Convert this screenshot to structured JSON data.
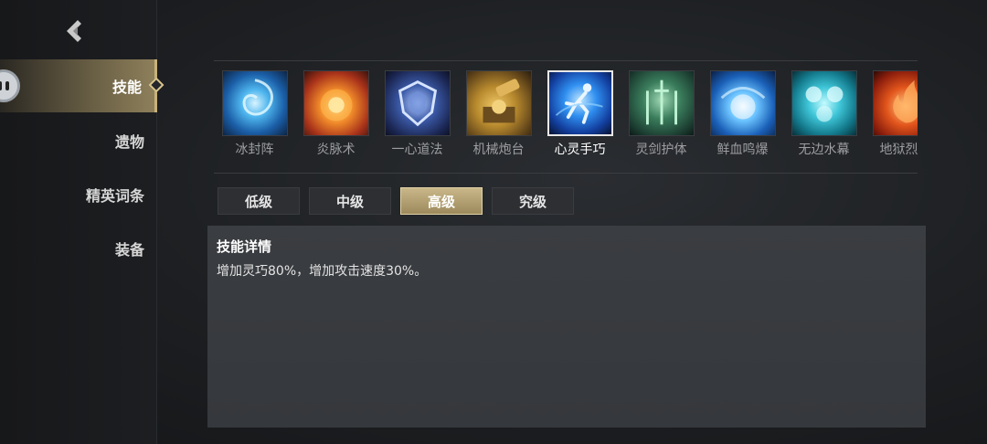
{
  "sidebar": {
    "items": [
      {
        "label": "技能",
        "active": true
      },
      {
        "label": "遗物",
        "active": false
      },
      {
        "label": "精英词条",
        "active": false
      },
      {
        "label": "装备",
        "active": false
      }
    ]
  },
  "skills": [
    {
      "label": "冰封阵",
      "icon": "ice-vortex-icon"
    },
    {
      "label": "炎脉术",
      "icon": "fire-orb-icon"
    },
    {
      "label": "一心道法",
      "icon": "shield-crest-icon"
    },
    {
      "label": "机械炮台",
      "icon": "cannon-turret-icon"
    },
    {
      "label": "心灵手巧",
      "icon": "dexterity-runner-icon",
      "selected": true
    },
    {
      "label": "灵剑护体",
      "icon": "spirit-swords-icon"
    },
    {
      "label": "鲜血鸣爆",
      "icon": "blood-burst-icon"
    },
    {
      "label": "无边水幕",
      "icon": "water-curtain-icon"
    },
    {
      "label": "地狱烈焰",
      "icon": "hell-flame-icon"
    }
  ],
  "tabs": [
    {
      "label": "低级",
      "active": false
    },
    {
      "label": "中级",
      "active": false
    },
    {
      "label": "高级",
      "active": true
    },
    {
      "label": "究级",
      "active": false
    }
  ],
  "detail": {
    "title": "技能详情",
    "text": "增加灵巧80%，增加攻击速度30%。"
  },
  "colors": {
    "accent_gold": "#c9b789",
    "panel_bg": "#3a3d41",
    "background": "#1d1f22"
  }
}
